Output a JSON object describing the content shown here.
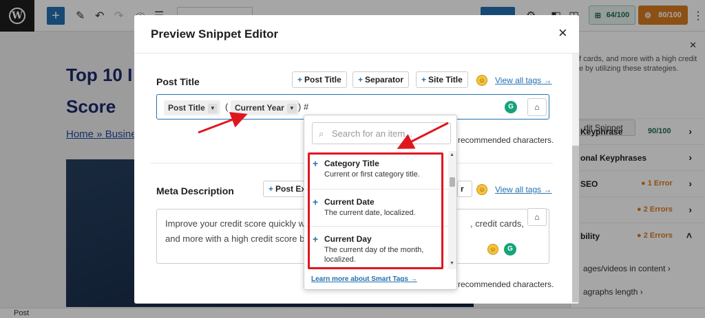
{
  "toolbar": {
    "score_seo": "64/100",
    "score_overall": "80/100"
  },
  "editor": {
    "title_line1": "Top 10 I",
    "title_line2": "Score",
    "breadcrumb_home": "Home",
    "breadcrumb_sep": " » ",
    "breadcrumb_next": "Busine"
  },
  "sidebar": {
    "snippet_line1": "f cards, and more with a high credit",
    "snippet_line2": "e by utilizing these strategies.",
    "edit_snippet_label": "dit Snippet",
    "rows": [
      {
        "label": "Keyphrase",
        "value": "90/100",
        "color": "#1e6b5a"
      },
      {
        "label": "onal Keyphrases",
        "value": "",
        "color": "#333333"
      },
      {
        "label": "SEO",
        "value": "● 1 Error",
        "color": "#d97b1f"
      },
      {
        "label": "",
        "value": "● 2 Errors",
        "color": "#d97b1f"
      },
      {
        "label": "bility",
        "value": "● 2 Errors",
        "color": "#d97b1f"
      }
    ],
    "sub1": "ages/videos in content",
    "sub2": "agraphs length"
  },
  "statusbar": {
    "label": "Post"
  },
  "modal": {
    "title": "Preview Snippet Editor",
    "close_icon": "×",
    "post_title": {
      "label": "Post Title",
      "btn_post_title": "Post Title",
      "btn_separator": "Separator",
      "btn_site_title": "Site Title",
      "view_all": "View all tags →",
      "chip1": "Post Title",
      "paren_open": "(",
      "chip2": "Current Year",
      "after_text": ") #",
      "hint": "recommended characters."
    },
    "meta": {
      "label": "Meta Description",
      "btn_post_ex": "Post Ex",
      "btn_partial": "r",
      "view_all": "View all tags →",
      "text_line1": "Improve your credit score quickly w",
      "text_line1_right": ", credit cards,",
      "text_line2": "and more with a high credit score b",
      "hint": "recommended characters."
    }
  },
  "dropdown": {
    "search_placeholder": "Search for an item...",
    "items": [
      {
        "name": "Category Title",
        "desc": "Current or first category title."
      },
      {
        "name": "Current Date",
        "desc": "The current date, localized."
      },
      {
        "name": "Current Day",
        "desc": "The current day of the month, localized."
      }
    ],
    "learn_more": "Learn more about Smart Tags →"
  },
  "colors": {
    "accent": "#2271b1",
    "highlight": "#e0161e",
    "grammarly": "#15a37a"
  }
}
